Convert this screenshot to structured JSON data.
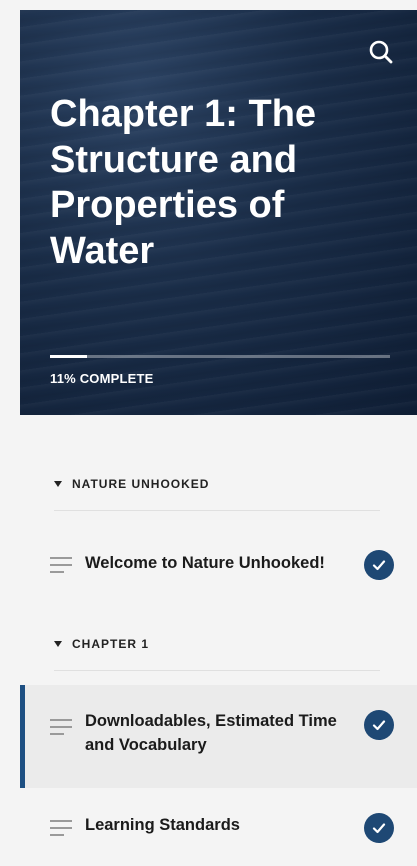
{
  "course": {
    "title": "Chapter 1: The Structure and Properties of Water",
    "progress_percent": 11,
    "progress_label": "11% COMPLETE"
  },
  "outline": {
    "sections": [
      {
        "title": "NATURE UNHOOKED",
        "lessons": [
          {
            "label": "Welcome to Nature Unhooked!",
            "completed": true,
            "active": false
          }
        ]
      },
      {
        "title": "CHAPTER 1",
        "lessons": [
          {
            "label": "Downloadables, Estimated Time and Vocabulary",
            "completed": true,
            "active": true
          },
          {
            "label": "Learning Standards",
            "completed": true,
            "active": false
          }
        ]
      }
    ]
  },
  "icons": {
    "search": "search-icon",
    "section_toggle": "caret-down-icon",
    "lesson": "lesson-lines-icon",
    "complete": "check-circle-icon"
  },
  "colors": {
    "accent": "#1e4874",
    "active_bar": "#1d4f82",
    "hero_bg": "#1a2d48"
  }
}
